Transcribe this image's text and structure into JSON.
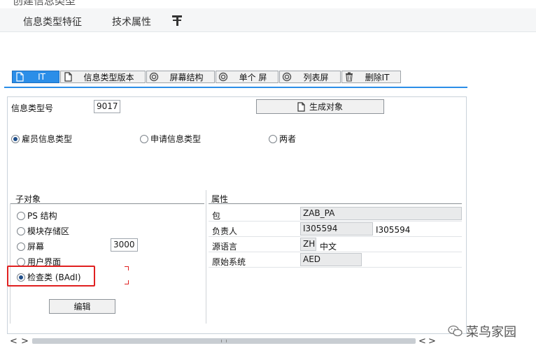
{
  "window": {
    "title_cut": "创建信息类型"
  },
  "menu": {
    "items": [
      "信息类型特征",
      "技术属性"
    ]
  },
  "tabs": [
    {
      "label": "IT",
      "icon": "document-icon",
      "active": true
    },
    {
      "label": "信息类型版本",
      "icon": "document-icon",
      "active": false
    },
    {
      "label": "屏幕结构",
      "icon": "radio-button-icon",
      "active": false
    },
    {
      "label": "单个 屏",
      "icon": "radio-button-icon",
      "active": false
    },
    {
      "label": "列表屏",
      "icon": "radio-button-icon",
      "active": false
    },
    {
      "label": "删除IT",
      "icon": "trash-icon",
      "active": false
    }
  ],
  "header": {
    "infotype_label": "信息类型号",
    "infotype_value": "9017",
    "generate_button": "生成对象"
  },
  "infotype_kind": {
    "options": [
      "雇员信息类型",
      "申请信息类型",
      "两者"
    ],
    "selected": "雇员信息类型"
  },
  "subobjects": {
    "title": "子对象",
    "options": [
      "PS 结构",
      "模块存储区",
      "屏幕",
      "用户界面",
      "检查类 (BAdI)"
    ],
    "selected": "检查类 (BAdI)",
    "screen_value": "3000",
    "edit_button": "编辑"
  },
  "attributes": {
    "title": "属性",
    "package_label": "包",
    "package_value": "ZAB_PA",
    "owner_label": "负责人",
    "owner_value": "I305594",
    "owner_name": "I305594",
    "language_label": "源语言",
    "language_value": "ZH",
    "language_name": "中文",
    "system_label": "原始系统",
    "system_value": "AED"
  },
  "scroll": {
    "left": "<",
    "right": ">",
    "prev": "<"
  },
  "watermark": {
    "text": "菜鸟家园"
  },
  "colors": {
    "accent": "#2b8ee8",
    "highlight": "#e02020"
  }
}
